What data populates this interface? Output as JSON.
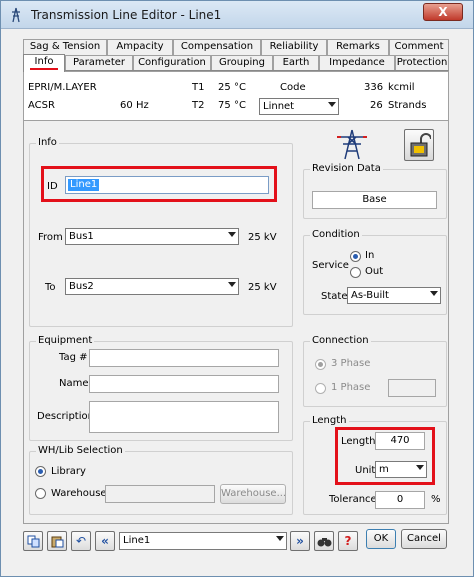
{
  "window": {
    "title": "Transmission Line Editor - Line1",
    "close_label": "X"
  },
  "tabs_back": [
    "Sag & Tension",
    "Ampacity",
    "Compensation",
    "Reliability",
    "Remarks",
    "Comment"
  ],
  "tabs_front": [
    "Info",
    "Parameter",
    "Configuration",
    "Grouping",
    "Earth",
    "Impedance",
    "Protection"
  ],
  "active_tab": "Info",
  "summary": {
    "library": "EPRI/M.LAYER",
    "conductor_type": "ACSR",
    "freq_value": "60",
    "freq_unit": "Hz",
    "t1_label": "T1",
    "t1_value": "25",
    "t1_unit": "°C",
    "t2_label": "T2",
    "t2_value": "75",
    "t2_unit": "°C",
    "code_label": "Code",
    "code_dropdown": "Linnet",
    "kcmil_value": "336",
    "kcmil_unit": "kcmil",
    "strands_value": "26",
    "strands_unit": "Strands"
  },
  "info": {
    "legend": "Info",
    "id_label": "ID",
    "id_value": "Line1",
    "from_label": "From",
    "from_value": "Bus1",
    "from_kv": "25 kV",
    "to_label": "To",
    "to_value": "Bus2",
    "to_kv": "25 kV"
  },
  "revision": {
    "legend": "Revision Data",
    "value": "Base"
  },
  "condition": {
    "legend": "Condition",
    "service_label": "Service",
    "in_label": "In",
    "out_label": "Out",
    "state_label": "State",
    "state_value": "As-Built"
  },
  "equipment": {
    "legend": "Equipment",
    "tag_label": "Tag #",
    "name_label": "Name",
    "description_label": "Description",
    "tag_value": "",
    "name_value": "",
    "description_value": ""
  },
  "connection": {
    "legend": "Connection",
    "three_phase_label": "3 Phase",
    "one_phase_label": "1 Phase"
  },
  "whlib": {
    "legend": "WH/Lib Selection",
    "library_label": "Library",
    "warehouse_label": "Warehouse",
    "warehouse_button": "Warehouse..."
  },
  "length": {
    "legend": "Length",
    "length_label": "Length",
    "length_value": "470",
    "unit_label": "Unit",
    "unit_value": "m",
    "tolerance_label": "Tolerance",
    "tolerance_value": "0",
    "tolerance_unit": "%"
  },
  "footer": {
    "element_value": "Line1",
    "ok_label": "OK",
    "cancel_label": "Cancel",
    "help_label": "?"
  },
  "colors": {
    "highlight": "#e3101a",
    "selection": "#3399ff"
  }
}
